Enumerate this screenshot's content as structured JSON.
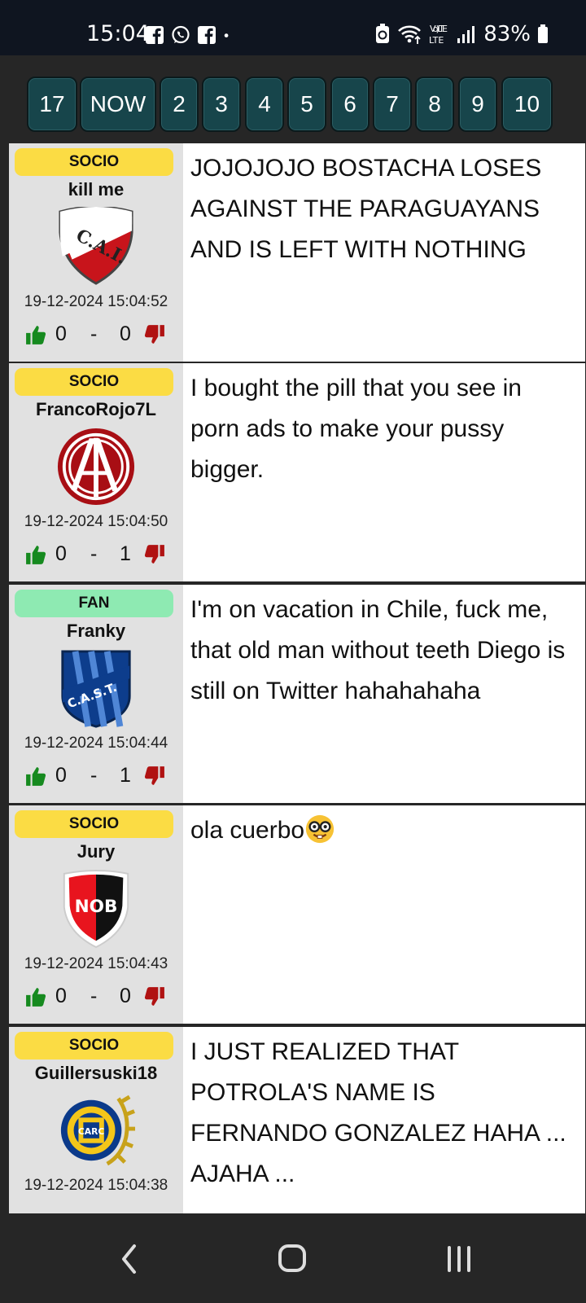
{
  "status_bar": {
    "time": "15:04",
    "battery": "83%",
    "network_label": "Vo) LTE",
    "left_icons": [
      "facebook-icon",
      "whatsapp-icon",
      "facebook-icon",
      "dot-icon"
    ],
    "right_icons": [
      "battery-saver-icon",
      "wifi-icon",
      "lte-icon",
      "signal-icon",
      "battery-icon"
    ]
  },
  "tabs": [
    "17",
    "NOW",
    "2",
    "3",
    "4",
    "5",
    "6",
    "7",
    "8",
    "9",
    "10"
  ],
  "posts": [
    {
      "badge": "SOCIO",
      "username": "kill me",
      "crest": "independiente-crest",
      "timestamp": "19-12-2024 15:04:52",
      "likes": "0",
      "separator": "-",
      "dislikes": "0",
      "text": "JOJOJOJO BOSTACHA LOSES AGAINST THE PARAGUAYANS AND IS LEFT WITH NOTHING"
    },
    {
      "badge": "SOCIO",
      "username": "FrancoRojo7L",
      "crest": "independiente-ca-crest",
      "timestamp": "19-12-2024 15:04:50",
      "likes": "0",
      "separator": "-",
      "dislikes": "1",
      "text": "I bought the pill that you see in porn ads to make your pussy bigger."
    },
    {
      "badge": "FAN",
      "username": "Franky",
      "crest": "san-telmo-crest",
      "timestamp": "19-12-2024 15:04:44",
      "likes": "0",
      "separator": "-",
      "dislikes": "1",
      "text": "I'm on vacation in Chile, fuck me, that old man without teeth Diego is still on Twitter hahahahaha"
    },
    {
      "badge": "SOCIO",
      "username": "Jury",
      "crest": "newells-crest",
      "timestamp": "19-12-2024 15:04:43",
      "likes": "0",
      "separator": "-",
      "dislikes": "0",
      "text": "ola cuerbo"
    },
    {
      "badge": "SOCIO",
      "username": "Guillersuski18",
      "crest": "rosario-central-crest",
      "timestamp": "19-12-2024 15:04:38",
      "text": "I JUST REALIZED THAT POTROLA'S NAME IS FERNANDO GONZALEZ HAHA ... AJAHA ..."
    }
  ],
  "crest_texts": {
    "independiente": "C.A.I.",
    "san_telmo": "C.A.S.T.",
    "newells": "NOB",
    "rosario_central": "CARC"
  },
  "nav_bar": [
    "back-icon",
    "home-icon",
    "recents-icon"
  ],
  "colors": {
    "tab_bg": "#17454b",
    "socio_badge": "#fbdc44",
    "fan_badge": "#8eeab2",
    "like_green": "#168a1f",
    "dislike_red": "#b01212"
  }
}
